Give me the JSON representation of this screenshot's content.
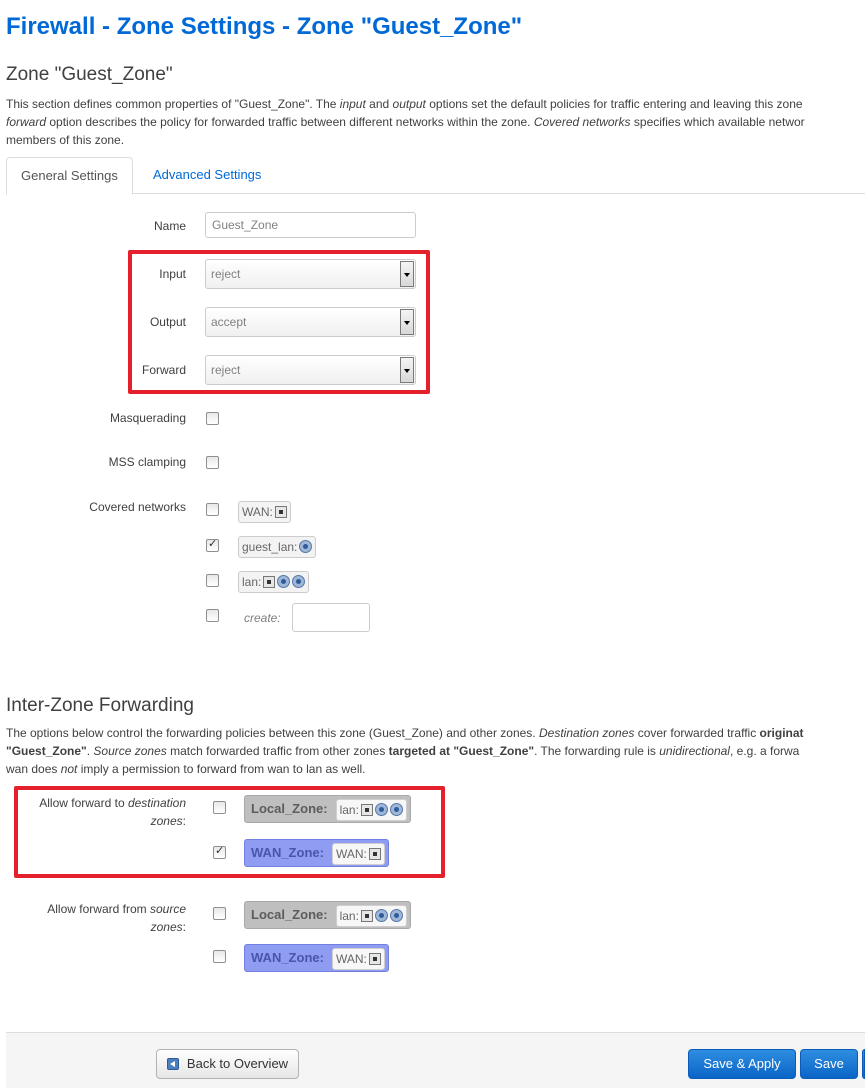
{
  "page": {
    "title": "Firewall - Zone Settings - Zone \"Guest_Zone\""
  },
  "zone_section": {
    "heading": "Zone \"Guest_Zone\"",
    "desc_line1_a": "This section defines common properties of \"Guest_Zone\". The ",
    "desc_line1_b": "input",
    "desc_line1_c": " and ",
    "desc_line1_d": "output",
    "desc_line1_e": " options set the default policies for traffic entering and leaving this zone",
    "desc_line2_a": "forward",
    "desc_line2_b": " option describes the policy for forwarded traffic between different networks within the zone. ",
    "desc_line2_c": "Covered networks",
    "desc_line2_d": " specifies which available networ",
    "desc_line3": "members of this zone."
  },
  "tabs": [
    {
      "label": "General Settings"
    },
    {
      "label": "Advanced Settings"
    }
  ],
  "form": {
    "name": {
      "label": "Name",
      "value": "Guest_Zone"
    },
    "input": {
      "label": "Input",
      "value": "reject"
    },
    "output": {
      "label": "Output",
      "value": "accept"
    },
    "forward": {
      "label": "Forward",
      "value": "reject"
    },
    "masquerading": {
      "label": "Masquerading",
      "checked": false
    },
    "mss_clamping": {
      "label": "MSS clamping",
      "checked": false
    },
    "covered_networks": {
      "label": "Covered networks",
      "items": [
        {
          "name": "WAN:",
          "checked": false,
          "icons": [
            "ethernet-port"
          ]
        },
        {
          "name": "guest_lan:",
          "checked": true,
          "icons": [
            "wireless"
          ]
        },
        {
          "name": "lan:",
          "checked": false,
          "icons": [
            "ethernet-port",
            "wireless",
            "wireless"
          ]
        }
      ],
      "create_label": "create:",
      "create_value": ""
    }
  },
  "forwarding": {
    "heading": "Inter-Zone Forwarding",
    "desc_line1_a": "The options below control the forwarding policies between this zone (Guest_Zone) and other zones. ",
    "desc_line1_b": "Destination zones",
    "desc_line1_c": " cover forwarded traffic ",
    "desc_line1_d": "originat",
    "desc_line2_a": "\"Guest_Zone\"",
    "desc_line2_b": ". ",
    "desc_line2_c": "Source zones",
    "desc_line2_d": " match forwarded traffic from other zones ",
    "desc_line2_e": "targeted at \"Guest_Zone\"",
    "desc_line2_f": ". The forwarding rule is ",
    "desc_line2_g": "unidirectional",
    "desc_line2_h": ", e.g. a forwa",
    "desc_line3_a": "wan does ",
    "desc_line3_b": "not",
    "desc_line3_c": " imply a permission to forward from wan to lan as well.",
    "dest": {
      "label_a": "Allow forward to ",
      "label_b": "destination",
      "label_c": "zones",
      "label_d": ":",
      "zones": [
        {
          "zone": "Local_Zone:",
          "net": "lan:",
          "checked": false
        },
        {
          "zone": "WAN_Zone:",
          "net": "WAN:",
          "checked": true
        }
      ]
    },
    "src": {
      "label_a": "Allow forward from ",
      "label_b": "source",
      "label_c": "zones",
      "label_d": ":",
      "zones": [
        {
          "zone": "Local_Zone:",
          "net": "lan:",
          "checked": false
        },
        {
          "zone": "WAN_Zone:",
          "net": "WAN:",
          "checked": false
        }
      ]
    }
  },
  "footer": {
    "back_label": "Back to Overview",
    "save_apply_label": "Save & Apply",
    "save_label": "Save"
  },
  "colors": {
    "title_blue": "#0069d6",
    "highlight_red": "#e3202b",
    "wan_zone": "#8e9cf2",
    "local_zone": "#bfbfbf",
    "primary_button": "#0a64c7"
  }
}
